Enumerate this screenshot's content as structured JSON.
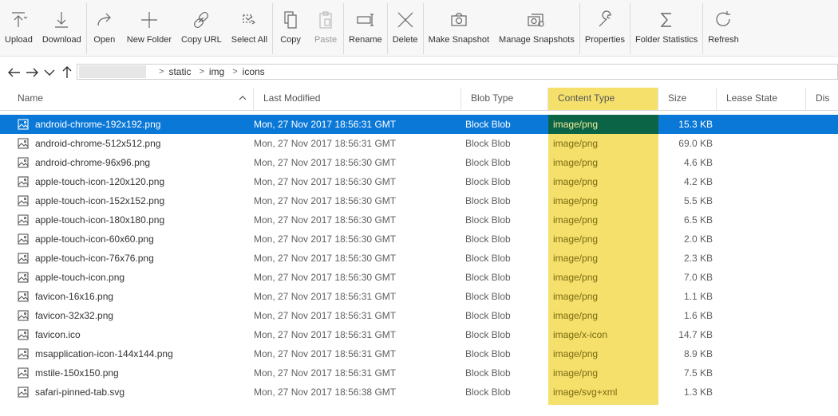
{
  "toolbar": {
    "groups": [
      [
        {
          "label": "Upload",
          "icon": "upload-icon"
        },
        {
          "label": "Download",
          "icon": "download-icon"
        }
      ],
      [
        {
          "label": "Open",
          "icon": "open-icon"
        },
        {
          "label": "New Folder",
          "icon": "plus-icon"
        },
        {
          "label": "Copy URL",
          "icon": "link-icon"
        },
        {
          "label": "Select All",
          "icon": "select-all-icon"
        }
      ],
      [
        {
          "label": "Copy",
          "icon": "copy-icon"
        },
        {
          "label": "Paste",
          "icon": "paste-icon",
          "disabled": true
        }
      ],
      [
        {
          "label": "Rename",
          "icon": "rename-icon"
        }
      ],
      [
        {
          "label": "Delete",
          "icon": "delete-icon"
        }
      ],
      [
        {
          "label": "Make Snapshot",
          "icon": "camera-icon"
        },
        {
          "label": "Manage Snapshots",
          "icon": "manage-snapshots-icon"
        }
      ],
      [
        {
          "label": "Properties",
          "icon": "wrench-icon"
        }
      ],
      [
        {
          "label": "Folder Statistics",
          "icon": "sigma-icon"
        }
      ],
      [
        {
          "label": "Refresh",
          "icon": "refresh-icon"
        }
      ]
    ]
  },
  "address": {
    "crumbs": [
      "static",
      "img",
      "icons"
    ]
  },
  "columns": {
    "name": "Name",
    "last_modified": "Last Modified",
    "blob_type": "Blob Type",
    "content_type": "Content Type",
    "size": "Size",
    "lease_state": "Lease State",
    "disposition": "Dis"
  },
  "rows": [
    {
      "name": "android-chrome-192x192.png",
      "modified": "Mon, 27 Nov 2017 18:56:31 GMT",
      "blob_type": "Block Blob",
      "content_type": "image/png",
      "size": "15.3 KB",
      "selected": true
    },
    {
      "name": "android-chrome-512x512.png",
      "modified": "Mon, 27 Nov 2017 18:56:31 GMT",
      "blob_type": "Block Blob",
      "content_type": "image/png",
      "size": "69.0 KB"
    },
    {
      "name": "android-chrome-96x96.png",
      "modified": "Mon, 27 Nov 2017 18:56:30 GMT",
      "blob_type": "Block Blob",
      "content_type": "image/png",
      "size": "4.6 KB"
    },
    {
      "name": "apple-touch-icon-120x120.png",
      "modified": "Mon, 27 Nov 2017 18:56:30 GMT",
      "blob_type": "Block Blob",
      "content_type": "image/png",
      "size": "4.2 KB"
    },
    {
      "name": "apple-touch-icon-152x152.png",
      "modified": "Mon, 27 Nov 2017 18:56:30 GMT",
      "blob_type": "Block Blob",
      "content_type": "image/png",
      "size": "5.5 KB"
    },
    {
      "name": "apple-touch-icon-180x180.png",
      "modified": "Mon, 27 Nov 2017 18:56:30 GMT",
      "blob_type": "Block Blob",
      "content_type": "image/png",
      "size": "6.5 KB"
    },
    {
      "name": "apple-touch-icon-60x60.png",
      "modified": "Mon, 27 Nov 2017 18:56:30 GMT",
      "blob_type": "Block Blob",
      "content_type": "image/png",
      "size": "2.0 KB"
    },
    {
      "name": "apple-touch-icon-76x76.png",
      "modified": "Mon, 27 Nov 2017 18:56:30 GMT",
      "blob_type": "Block Blob",
      "content_type": "image/png",
      "size": "2.3 KB"
    },
    {
      "name": "apple-touch-icon.png",
      "modified": "Mon, 27 Nov 2017 18:56:30 GMT",
      "blob_type": "Block Blob",
      "content_type": "image/png",
      "size": "7.0 KB"
    },
    {
      "name": "favicon-16x16.png",
      "modified": "Mon, 27 Nov 2017 18:56:31 GMT",
      "blob_type": "Block Blob",
      "content_type": "image/png",
      "size": "1.1 KB"
    },
    {
      "name": "favicon-32x32.png",
      "modified": "Mon, 27 Nov 2017 18:56:31 GMT",
      "blob_type": "Block Blob",
      "content_type": "image/png",
      "size": "1.6 KB"
    },
    {
      "name": "favicon.ico",
      "modified": "Mon, 27 Nov 2017 18:56:31 GMT",
      "blob_type": "Block Blob",
      "content_type": "image/x-icon",
      "size": "14.7 KB"
    },
    {
      "name": "msapplication-icon-144x144.png",
      "modified": "Mon, 27 Nov 2017 18:56:31 GMT",
      "blob_type": "Block Blob",
      "content_type": "image/png",
      "size": "8.9 KB"
    },
    {
      "name": "mstile-150x150.png",
      "modified": "Mon, 27 Nov 2017 18:56:31 GMT",
      "blob_type": "Block Blob",
      "content_type": "image/png",
      "size": "7.5 KB"
    },
    {
      "name": "safari-pinned-tab.svg",
      "modified": "Mon, 27 Nov 2017 18:56:38 GMT",
      "blob_type": "Block Blob",
      "content_type": "image/svg+xml",
      "size": "1.3 KB"
    }
  ],
  "colors": {
    "selection": "#0a78d7",
    "highlight_column": "#f5e06c"
  }
}
